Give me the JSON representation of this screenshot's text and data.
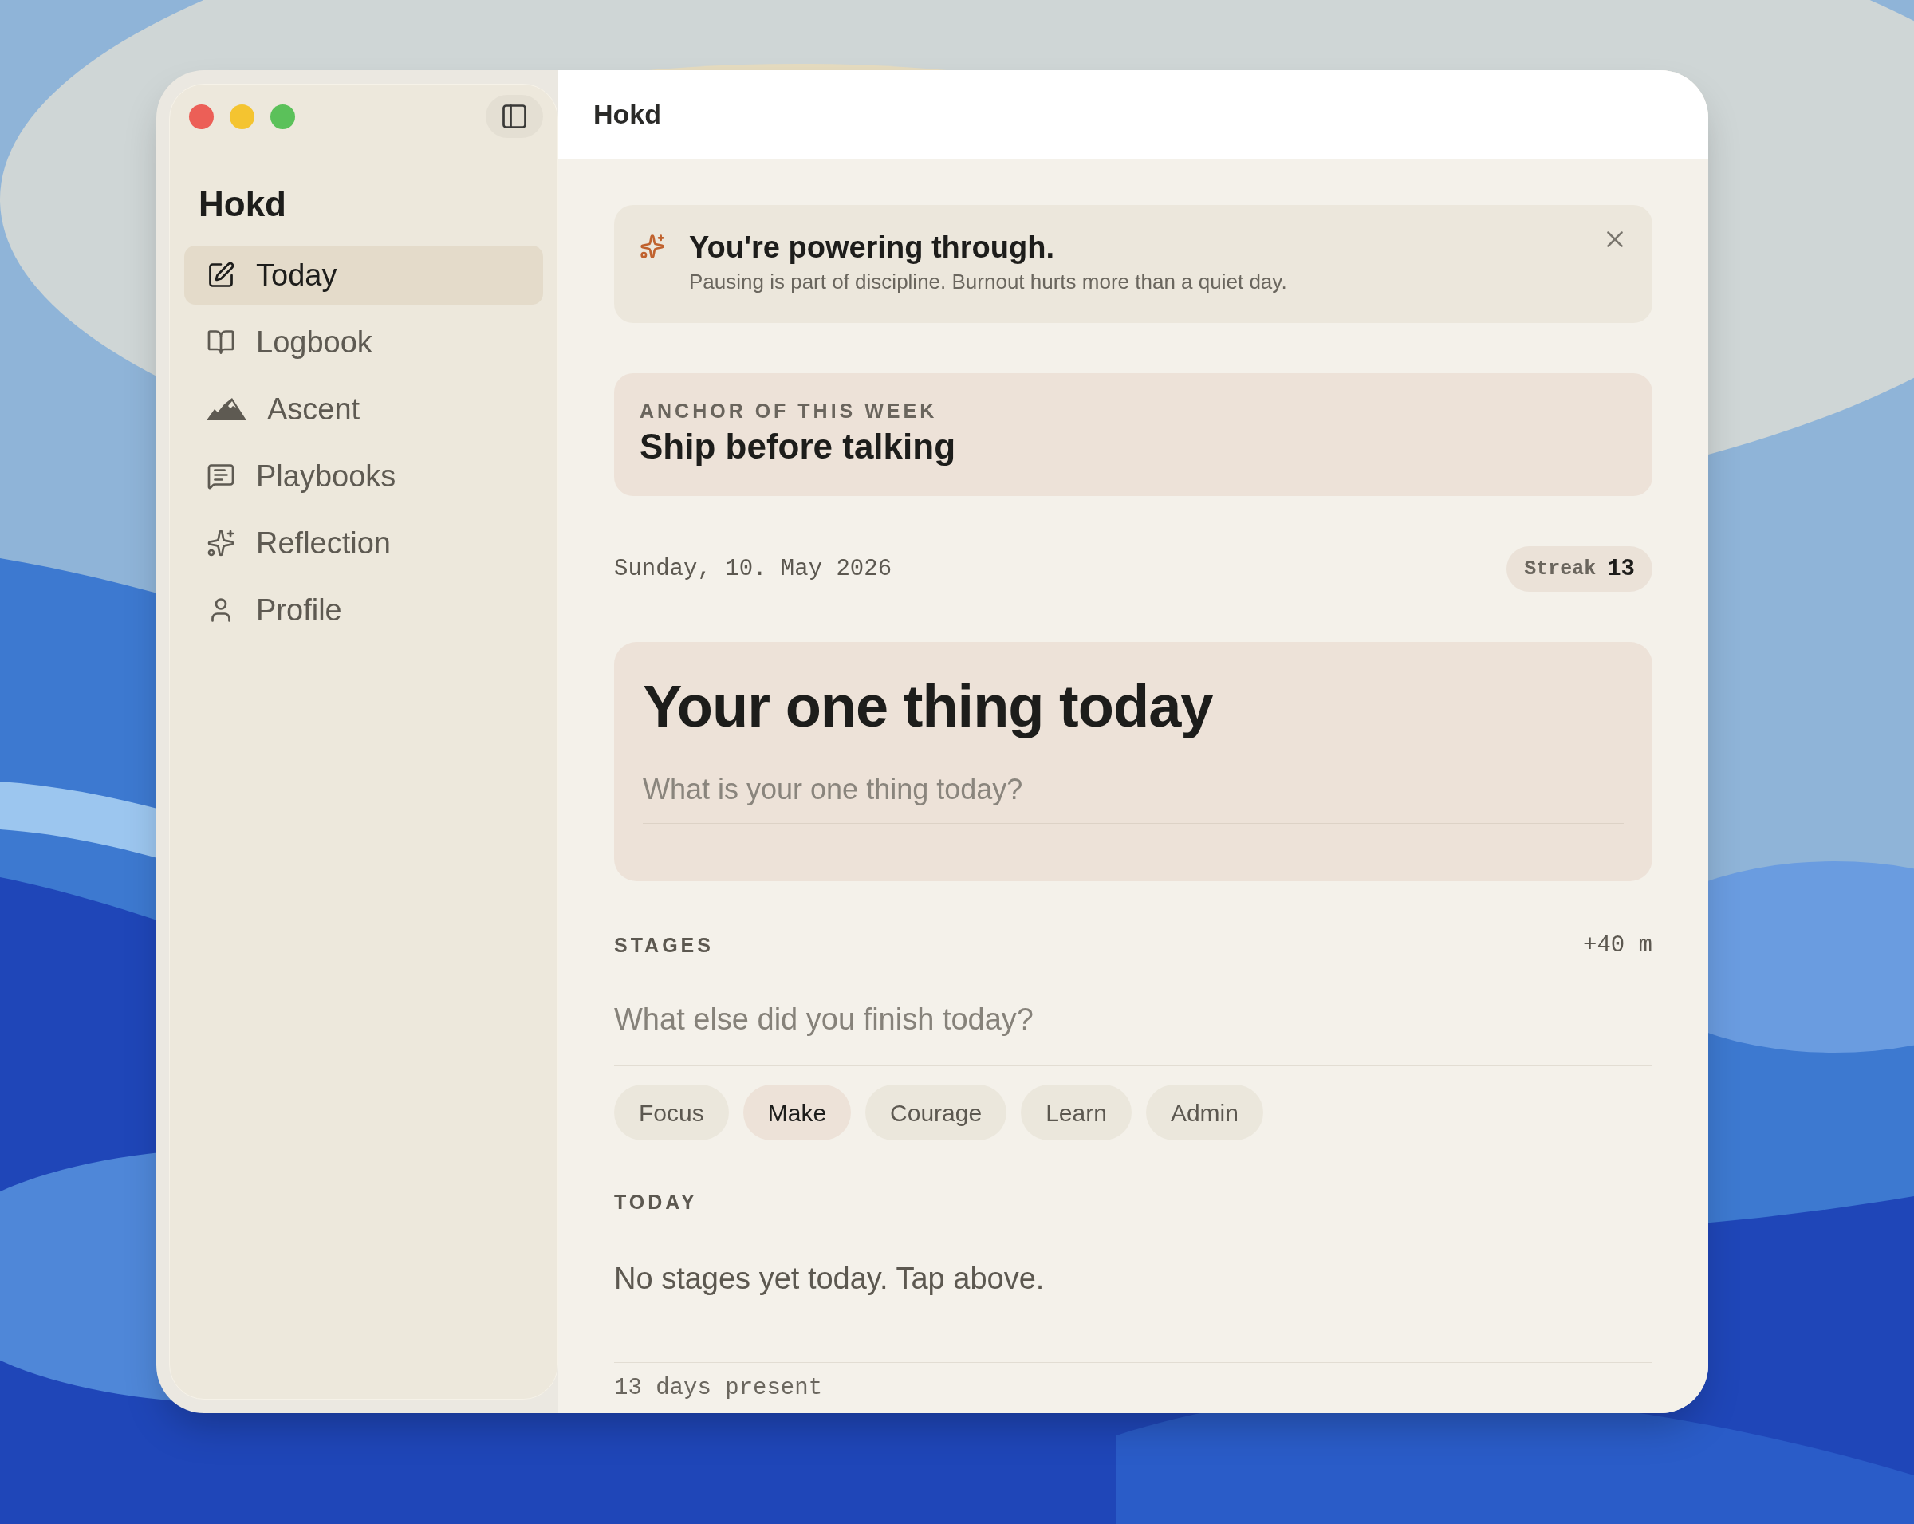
{
  "window": {
    "title": "Hokd"
  },
  "sidebar": {
    "title": "Hokd",
    "items": [
      {
        "label": "Today",
        "selected": true
      },
      {
        "label": "Logbook",
        "selected": false
      },
      {
        "label": "Ascent",
        "selected": false
      },
      {
        "label": "Playbooks",
        "selected": false
      },
      {
        "label": "Reflection",
        "selected": false
      },
      {
        "label": "Profile",
        "selected": false
      }
    ]
  },
  "banner": {
    "title": "You're powering through.",
    "message": "Pausing is part of discipline. Burnout hurts more than a quiet day."
  },
  "anchor": {
    "label": "ANCHOR OF THIS WEEK",
    "title": "Ship before talking"
  },
  "date": "Sunday, 10. May 2026",
  "streak": {
    "label": "Streak",
    "value": "13"
  },
  "one_thing": {
    "title": "Your one thing today",
    "placeholder": "What is your one thing today?"
  },
  "stages": {
    "label": "STAGES",
    "total": "+40 m",
    "placeholder": "What else did you finish today?",
    "chips": [
      {
        "label": "Focus",
        "selected": false
      },
      {
        "label": "Make",
        "selected": true
      },
      {
        "label": "Courage",
        "selected": false
      },
      {
        "label": "Learn",
        "selected": false
      },
      {
        "label": "Admin",
        "selected": false
      }
    ]
  },
  "today": {
    "label": "TODAY",
    "empty_message": "No stages yet today. Tap above."
  },
  "footer": "13 days present"
}
